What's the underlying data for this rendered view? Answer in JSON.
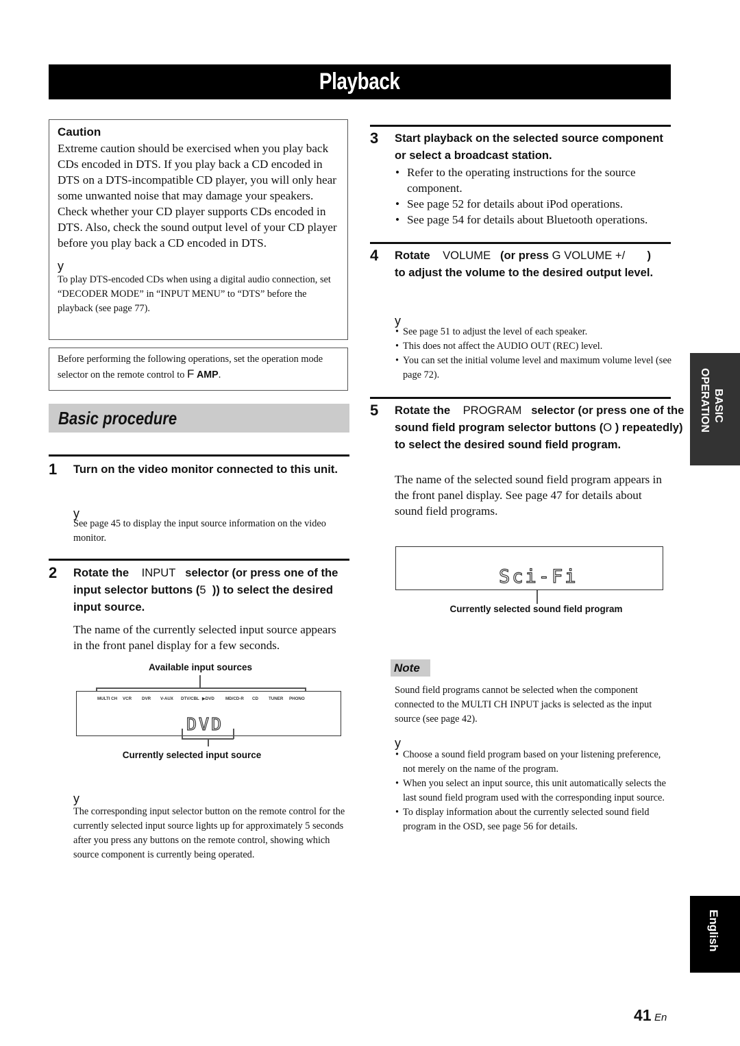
{
  "page": {
    "title": "Playback",
    "page_number": "41",
    "page_lang_suffix": "En",
    "side_tabs": {
      "section_line1": "BASIC",
      "section_line2": "OPERATION",
      "language": "English"
    }
  },
  "caution": {
    "heading": "Caution",
    "body": "Extreme caution should be exercised when you play back CDs encoded in DTS. If you play back a CD encoded in DTS on a DTS-incompatible CD player, you will only hear some unwanted noise that may damage your speakers. Check whether your CD player supports CDs encoded in DTS. Also, check the sound output level of your CD player before you play back a CD encoded in DTS.",
    "tip_glyph": "y",
    "tip": "To play DTS-encoded CDs when using a digital audio connection, set “DECODER MODE” in “INPUT MENU” to “DTS” before the playback (see page 77)."
  },
  "before_note": {
    "text": "Before performing the following operations, set the operation mode selector on the remote control to",
    "key_glyph": "F",
    "key_label": "AMP",
    "end": "."
  },
  "section": {
    "heading": "Basic procedure"
  },
  "steps": [
    {
      "number": "1",
      "heading": "Turn on the video monitor connected to this unit.",
      "tip_glyph": "y",
      "tip": "See page 45 to display the input source information on the video monitor."
    },
    {
      "number": "2",
      "heading_a": "Rotate the",
      "heading_control": "INPUT",
      "heading_b": "selector (or press one of the input selector buttons (",
      "heading_glyph": "5",
      "heading_c": ")) to select the desired input source.",
      "body": "The name of the currently selected input source appears in the front panel display for a few seconds.",
      "figure": {
        "top_caption": "Available input sources",
        "sources": [
          "MULTI CH",
          "VCR",
          "DVR",
          "V-AUX",
          "DTV/CBL",
          "▶DVD",
          "MD/CD-R",
          "CD",
          "TUNER",
          "PHONO"
        ],
        "display_text": "DVD",
        "bottom_caption": "Currently selected input source"
      },
      "tip_glyph": "y",
      "tip": "The corresponding input selector button on the remote control for the currently selected input source lights up for approximately 5 seconds after you press any buttons on the remote control, showing which source component is currently being operated."
    },
    {
      "number": "3",
      "heading": "Start playback on the selected source component or select a broadcast station.",
      "bullets": [
        "Refer to the operating instructions for the source component.",
        "See page 52 for details about iPod operations.",
        "See page 54 for details about Bluetooth operations."
      ]
    },
    {
      "number": "4",
      "heading_a": "Rotate",
      "heading_control": "VOLUME",
      "heading_b": "(or press",
      "heading_glyph": "G",
      "heading_control2": "VOLUME +/",
      "heading_c": ")",
      "heading_d": "to adjust the volume to the desired output level.",
      "tip_glyph": "y",
      "tips": [
        "See page 51 to adjust the level of each speaker.",
        "This does not affect the AUDIO OUT (REC) level.",
        "You can set the initial volume level and maximum volume level (see page 72)."
      ]
    },
    {
      "number": "5",
      "heading_a": "Rotate the",
      "heading_control": "PROGRAM",
      "heading_b": "selector (or press one of the sound field program selector buttons (",
      "heading_glyph": "O",
      "heading_c": ") repeatedly) to select the desired sound field program.",
      "body": "The name of the selected sound field program appears in the front panel display. See page 47 for details about sound field programs.",
      "figure": {
        "display_text": "Sci-Fi",
        "caption": "Currently selected sound field program"
      }
    }
  ],
  "note": {
    "label": "Note",
    "text": "Sound field programs cannot be selected when the component connected to the MULTI CH INPUT jacks is selected as the input source (see page 42).",
    "tip_glyph": "y",
    "tips": [
      "Choose a sound field program based on your listening preference, not merely on the name of the program.",
      "When you select an input source, this unit automatically selects the last sound field program used with the corresponding input source.",
      "To display information about the currently selected sound field program in the OSD, see page 56 for details."
    ]
  }
}
